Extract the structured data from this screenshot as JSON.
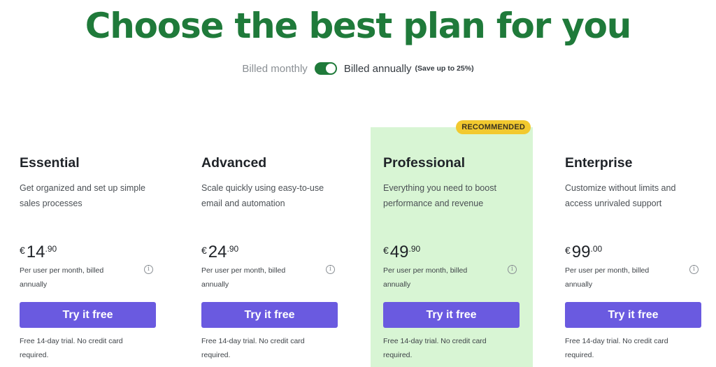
{
  "header": {
    "title": "Choose the best plan for you"
  },
  "billing_toggle": {
    "left_label": "Billed monthly",
    "right_label": "Billed annually",
    "save_note": "(Save up to 25%)",
    "selected": "annually",
    "accent_color": "#1f7a3a"
  },
  "plans": [
    {
      "name": "Essential",
      "description": "Get organized and set up simple sales processes",
      "currency": "€",
      "price_int": "14",
      "price_dec": ".90",
      "per": "Per user per month, billed annually",
      "info_icon": "info-icon",
      "cta": "Try it free",
      "trial": "Free 14-day trial. No credit card required.",
      "recommended": false
    },
    {
      "name": "Advanced",
      "description": "Scale quickly using easy-to-use email and automation",
      "currency": "€",
      "price_int": "24",
      "price_dec": ".90",
      "per": "Per user per month, billed annually",
      "info_icon": "info-icon",
      "cta": "Try it free",
      "trial": "Free 14-day trial. No credit card required.",
      "recommended": false
    },
    {
      "name": "Professional",
      "description": "Everything you need to boost performance and revenue",
      "currency": "€",
      "price_int": "49",
      "price_dec": ".90",
      "per": "Per user per month, billed annually",
      "info_icon": "info-icon",
      "cta": "Try it free",
      "trial": "Free 14-day trial. No credit card required.",
      "recommended": true,
      "badge": "RECOMMENDED"
    },
    {
      "name": "Enterprise",
      "description": "Customize without limits and access unrivaled support",
      "currency": "€",
      "price_int": "99",
      "price_dec": ".00",
      "per": "Per user per month, billed annually",
      "info_icon": "info-icon",
      "cta": "Try it free",
      "trial": "Free 14-day trial. No credit card required.",
      "recommended": false
    }
  ],
  "colors": {
    "title_green": "#1f7a3a",
    "cta_purple": "#6a5ae0",
    "highlight_bg": "#d8f5d4",
    "badge_yellow": "#f2c92f"
  }
}
